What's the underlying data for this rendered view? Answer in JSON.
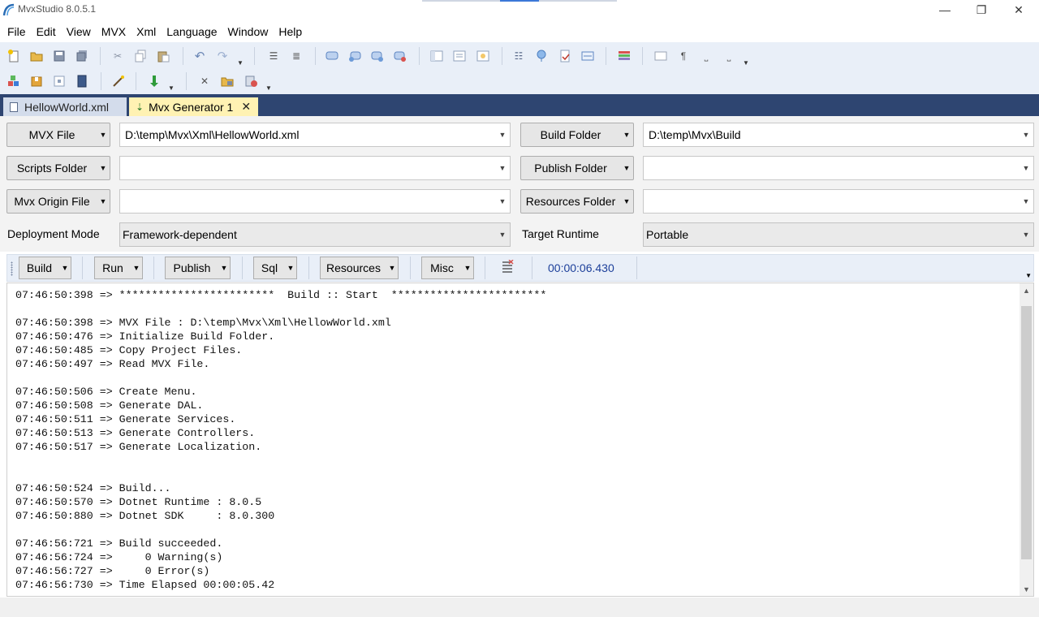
{
  "window": {
    "title": "MvxStudio 8.0.5.1",
    "minimize_glyph": "—",
    "restore_glyph": "❐",
    "close_glyph": "✕"
  },
  "menu": [
    "File",
    "Edit",
    "View",
    "MVX",
    "Xml",
    "Language",
    "Window",
    "Help"
  ],
  "toolbar_icons": {
    "row1": [
      "new-file-icon",
      "open-folder-icon",
      "save-icon",
      "save-all-icon",
      "cut-icon",
      "copy-icon",
      "paste-icon",
      "undo-icon",
      "redo-icon",
      "indent-icon",
      "outdent-icon",
      "comment-bubble-icon",
      "comment-add-icon",
      "comment-next-icon",
      "comment-remove-icon",
      "panel-left-icon",
      "panel-list-icon",
      "panel-image-icon",
      "numbered-list-icon",
      "pin-icon",
      "document-check-icon",
      "wrap-icon",
      "layers-icon",
      "frame-icon",
      "pilcrow-icon",
      "space-icon",
      "whitespace-icon"
    ],
    "row2": [
      "components-icon",
      "package-icon",
      "module-icon",
      "book-icon",
      "magic-wand-icon",
      "build-download-icon",
      "tools-icon",
      "folder-tools-icon",
      "clear-build-icon"
    ]
  },
  "tabs": [
    {
      "label": "HellowWorld.xml",
      "active": false
    },
    {
      "label": "Mvx Generator 1",
      "active": true,
      "close": "✕"
    }
  ],
  "form": {
    "mvx_file_button": "MVX File",
    "mvx_file_value": "D:\\temp\\Mvx\\Xml\\HellowWorld.xml",
    "scripts_folder_button": "Scripts Folder",
    "scripts_folder_value": "",
    "mvx_origin_button": "Mvx Origin File",
    "mvx_origin_value": "",
    "build_folder_button": "Build Folder",
    "build_folder_value": "D:\\temp\\Mvx\\Build",
    "publish_folder_button": "Publish Folder",
    "publish_folder_value": "",
    "resources_folder_button": "Resources Folder",
    "resources_folder_value": "",
    "deployment_mode_label": "Deployment Mode",
    "deployment_mode_value": "Framework-dependent",
    "target_runtime_label": "Target Runtime",
    "target_runtime_value": "Portable"
  },
  "commands": {
    "build": "Build",
    "run": "Run",
    "publish": "Publish",
    "sql": "Sql",
    "resources": "Resources",
    "misc": "Misc",
    "elapsed": "00:00:06.430"
  },
  "log_lines": [
    "07:46:50:398 => ************************  Build :: Start  ************************",
    "",
    "07:46:50:398 => MVX File : D:\\temp\\Mvx\\Xml\\HellowWorld.xml",
    "07:46:50:476 => Initialize Build Folder.",
    "07:46:50:485 => Copy Project Files.",
    "07:46:50:497 => Read MVX File.",
    "",
    "07:46:50:506 => Create Menu.",
    "07:46:50:508 => Generate DAL.",
    "07:46:50:511 => Generate Services.",
    "07:46:50:513 => Generate Controllers.",
    "07:46:50:517 => Generate Localization.",
    "",
    "",
    "07:46:50:524 => Build...",
    "07:46:50:570 => Dotnet Runtime : 8.0.5",
    "07:46:50:880 => Dotnet SDK     : 8.0.300",
    "",
    "07:46:56:721 => Build succeeded.",
    "07:46:56:724 =>     0 Warning(s)",
    "07:46:56:727 =>     0 Error(s)",
    "07:46:56:730 => Time Elapsed 00:00:05.42"
  ],
  "colors": {
    "tab_strip": "#2e4571",
    "active_tab": "#fff2b3",
    "toolbar_bg": "#e9eff8",
    "elapsed_text": "#1c3f9a"
  }
}
